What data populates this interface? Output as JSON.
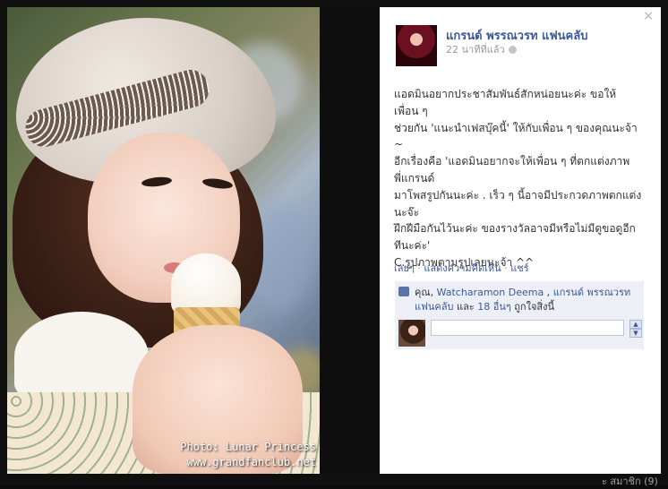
{
  "photo": {
    "watermark_line1": "Photo: Lunar Princess",
    "watermark_line2": "www.grandfanclub.net"
  },
  "post": {
    "close_label": "×",
    "page_name": "แกรนด์ พรรณวรท แฟนคลับ",
    "timestamp": "22 นาทีที่แล้ว",
    "privacy_icon": "globe-icon",
    "lines": [
      "แอดมินอยากประชาสัมพันธ์สักหน่อยนะค่ะ ขอให้",
      "เพื่อน ๆ",
      "ช่วยกัน 'แนะนำเฟสบุ๊คนี้' ให้กับเพื่อน ๆ ของคุณนะจ้า",
      "~",
      "อีกเรื่องคือ 'แอดมินอยากจะให้เพื่อน ๆ ที่ตกแต่งภาพ",
      "พี่แกรนด์",
      "มาโพสรูปกันนะค่ะ . เร็ว ๆ นี้อาจมีประกวดภาพตกแต่ง",
      "นะจ๊ะ",
      "ฝึกฝีมือกันไว้นะค่ะ ของรางวัลอาจมีหรือไม่มีดูขอดูอีก",
      "ทีนะค่ะ'",
      "C.รูปภาพตามรูปเลยนะจ้า ^^"
    ]
  },
  "actions": {
    "like": "เลยๆ",
    "comment": "แสดงความคิดเห็น",
    "share": "แชร์",
    "separator": " · "
  },
  "likes": {
    "icon": "thumbs-up-icon",
    "prefix": "คุณ, ",
    "name1": "Watcharamon Deema",
    "comma": " , ",
    "name2": "แกรนด์ พรรณวรท แฟนคลับ",
    "and": " และ ",
    "others": "18 อื่นๆ",
    "suffix": " ถูกใจสิ่งนี้"
  },
  "comment_box": {
    "placeholder": "",
    "scroll_up": "▲",
    "scroll_down": "▼"
  },
  "footer": {
    "text": "ะ สมาชิก (9)"
  }
}
